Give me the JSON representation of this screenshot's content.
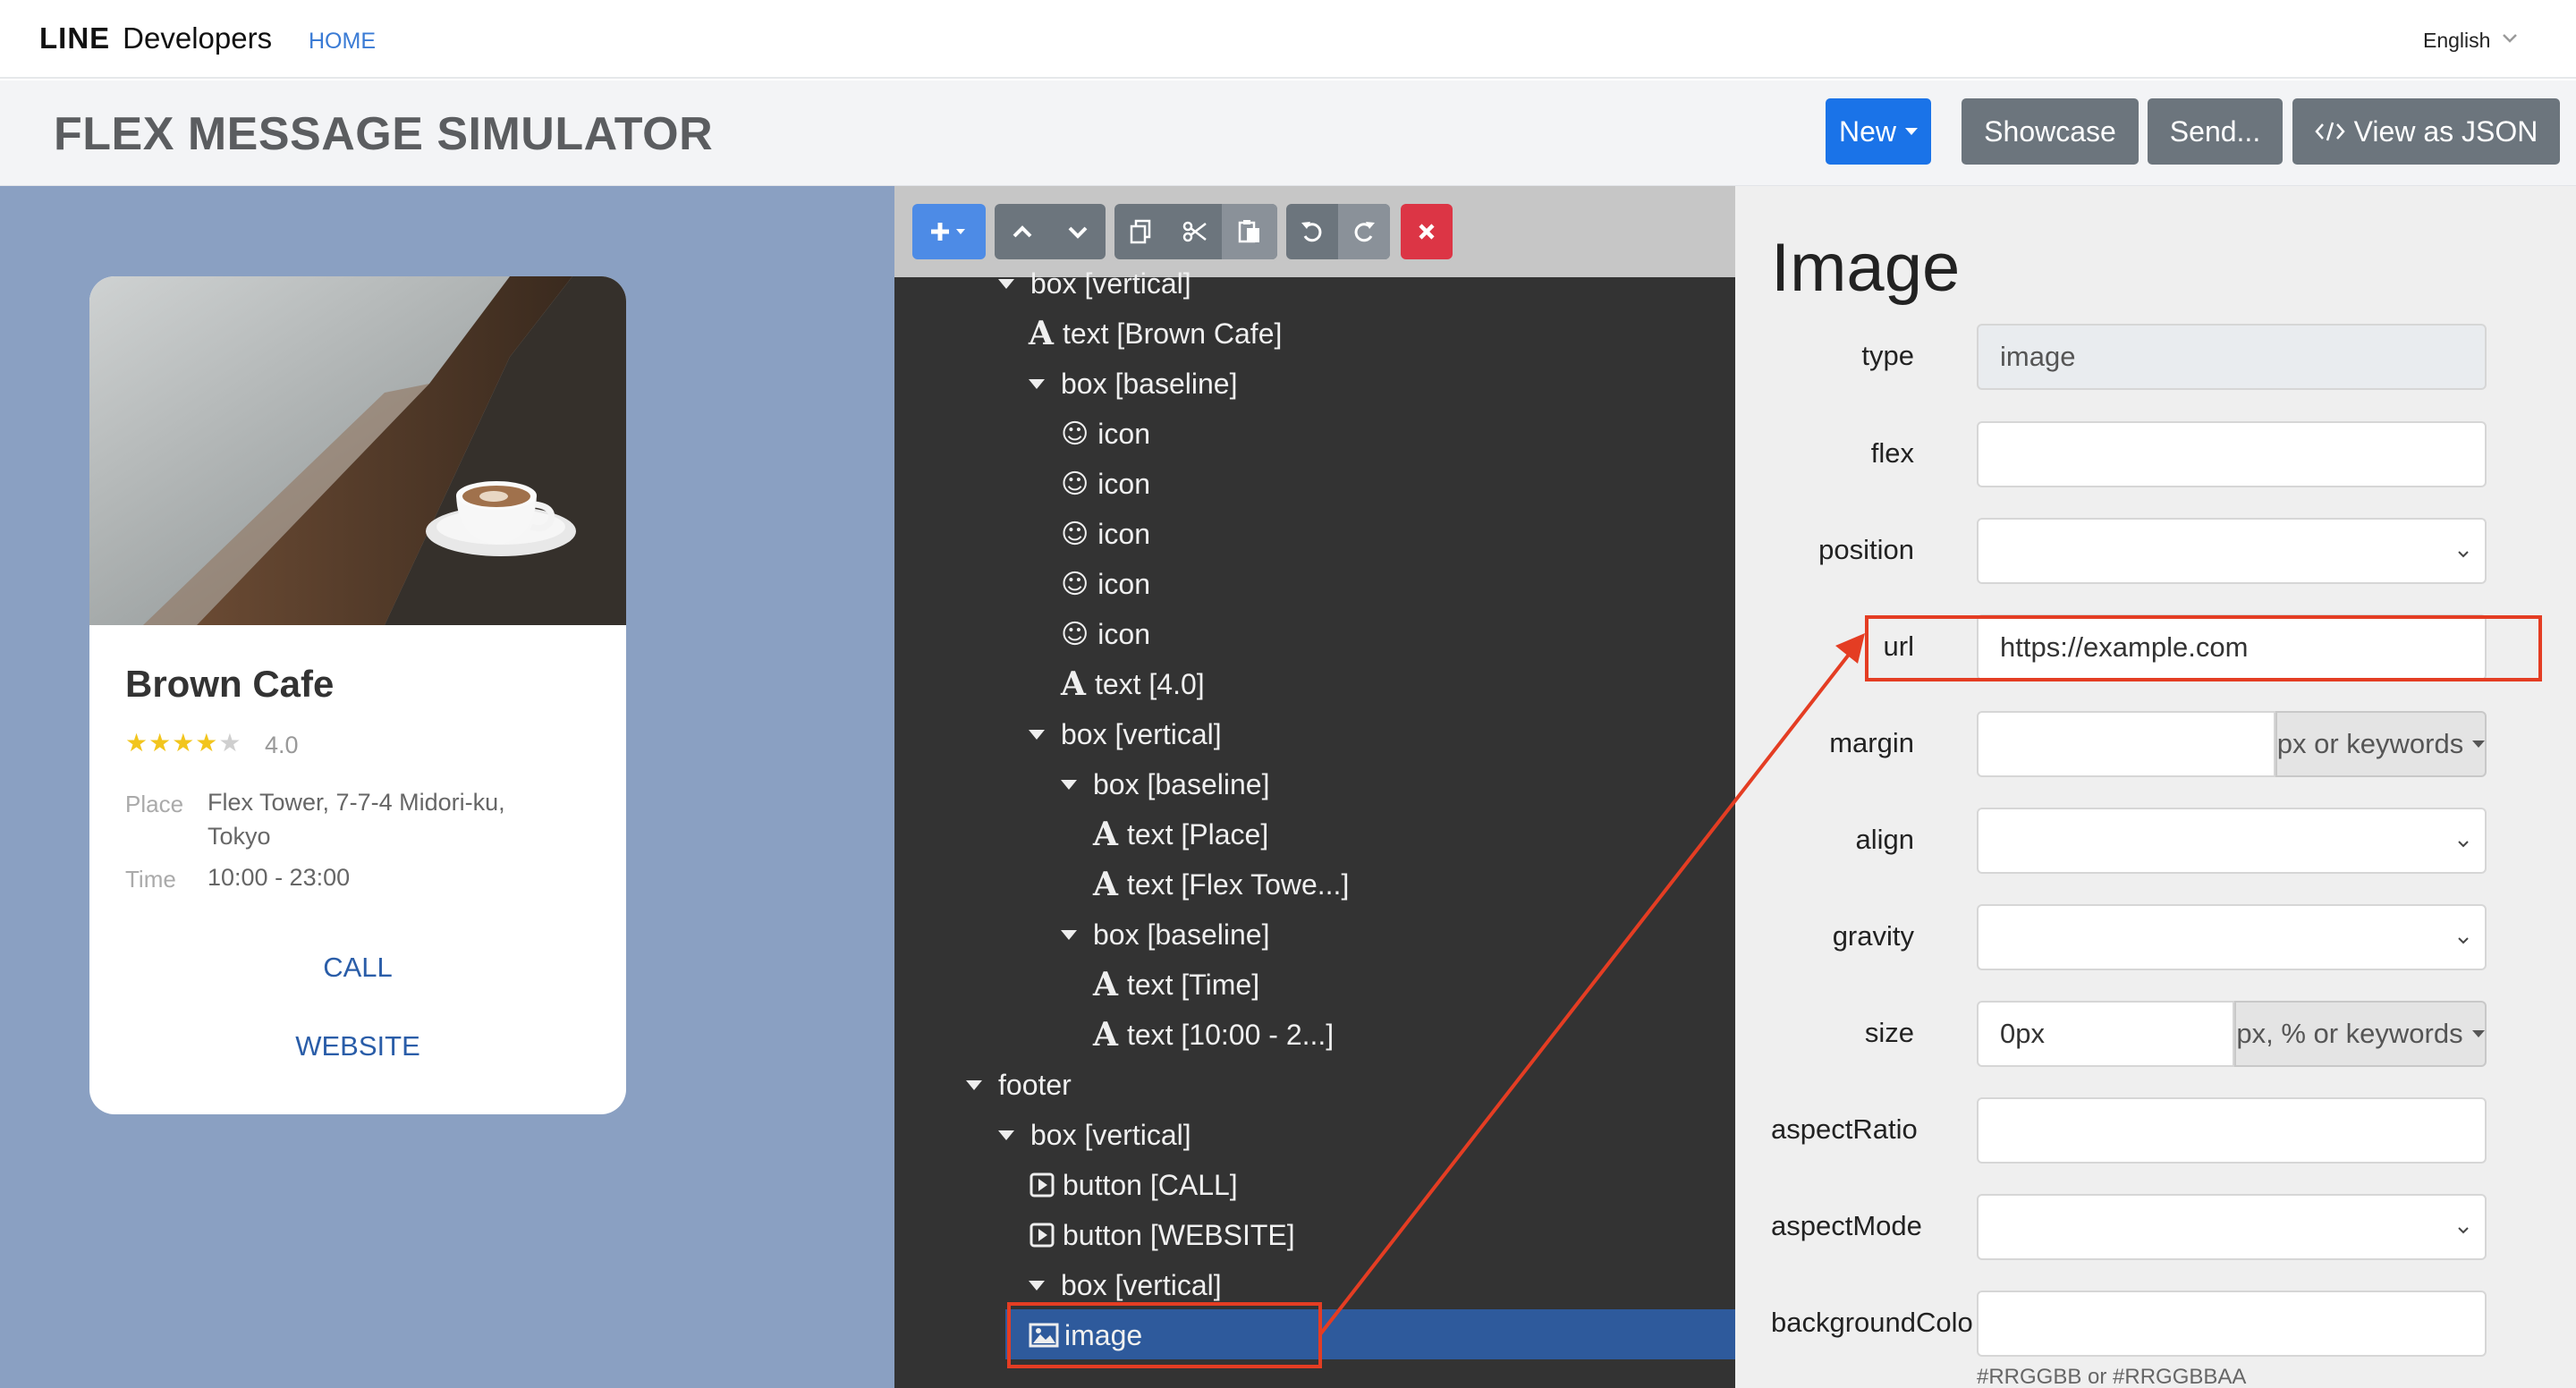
{
  "nav": {
    "brand_line": "LINE",
    "brand_developers": "Developers",
    "home": "HOME",
    "language": "English"
  },
  "header": {
    "title": "FLEX MESSAGE SIMULATOR",
    "new_label": "New",
    "showcase_label": "Showcase",
    "send_label": "Send...",
    "json_label": "View as JSON"
  },
  "preview": {
    "title": "Brown Cafe",
    "stars_full": "★★★★",
    "stars_empty": "★",
    "rating": "4.0",
    "place_label": "Place",
    "place_value_1": "Flex Tower, 7-7-4 Midori-ku,",
    "place_value_2": "Tokyo",
    "time_label": "Time",
    "time_value": "10:00 - 23:00",
    "call_label": "CALL",
    "website_label": "WEBSITE"
  },
  "tree": {
    "nodes": [
      {
        "icon": "triangle",
        "label": "box [vertical]"
      },
      {
        "icon": "text",
        "label": "text [Brown Cafe]"
      },
      {
        "icon": "triangle",
        "label": "box [baseline]"
      },
      {
        "icon": "smile",
        "label": "icon"
      },
      {
        "icon": "smile",
        "label": "icon"
      },
      {
        "icon": "smile",
        "label": "icon"
      },
      {
        "icon": "smile",
        "label": "icon"
      },
      {
        "icon": "smile",
        "label": "icon"
      },
      {
        "icon": "text",
        "label": "text [4.0]"
      },
      {
        "icon": "triangle",
        "label": "box [vertical]"
      },
      {
        "icon": "triangle",
        "label": "box [baseline]"
      },
      {
        "icon": "text",
        "label": "text [Place]"
      },
      {
        "icon": "text",
        "label": "text [Flex Towe...]"
      },
      {
        "icon": "triangle",
        "label": "box [baseline]"
      },
      {
        "icon": "text",
        "label": "text [Time]"
      },
      {
        "icon": "text",
        "label": "text [10:00 - 2...]"
      },
      {
        "icon": "triangle",
        "label": "footer"
      },
      {
        "icon": "triangle",
        "label": "box [vertical]"
      },
      {
        "icon": "button",
        "label": "button [CALL]"
      },
      {
        "icon": "button",
        "label": "button [WEBSITE]"
      },
      {
        "icon": "triangle",
        "label": "box [vertical]"
      },
      {
        "icon": "image",
        "label": "image"
      }
    ]
  },
  "props": {
    "title": "Image",
    "fields": {
      "type": {
        "label": "type",
        "value": "image"
      },
      "flex": {
        "label": "flex",
        "value": ""
      },
      "position": {
        "label": "position",
        "value": ""
      },
      "url": {
        "label": "url",
        "value": "https://example.com"
      },
      "margin": {
        "label": "margin",
        "value": "",
        "unit": "px or keywords"
      },
      "align": {
        "label": "align",
        "value": ""
      },
      "gravity": {
        "label": "gravity",
        "value": ""
      },
      "size": {
        "label": "size",
        "value": "0px",
        "unit": "px, % or keywords"
      },
      "aspectRatio": {
        "label": "aspectRatio",
        "value": ""
      },
      "aspectMode": {
        "label": "aspectMode",
        "value": ""
      },
      "backgroundColor": {
        "label": "backgroundColo",
        "value": "",
        "hint": "#RRGGBB or #RRGGBBAA"
      }
    }
  },
  "colors": {
    "primary": "#1a73e8",
    "secondary": "#6c757d",
    "danger": "#e03a3a",
    "highlight": "#e43d23",
    "selected": "#2e5a9c",
    "tree_bg": "#333333",
    "preview_bg": "#8aa0c2"
  }
}
